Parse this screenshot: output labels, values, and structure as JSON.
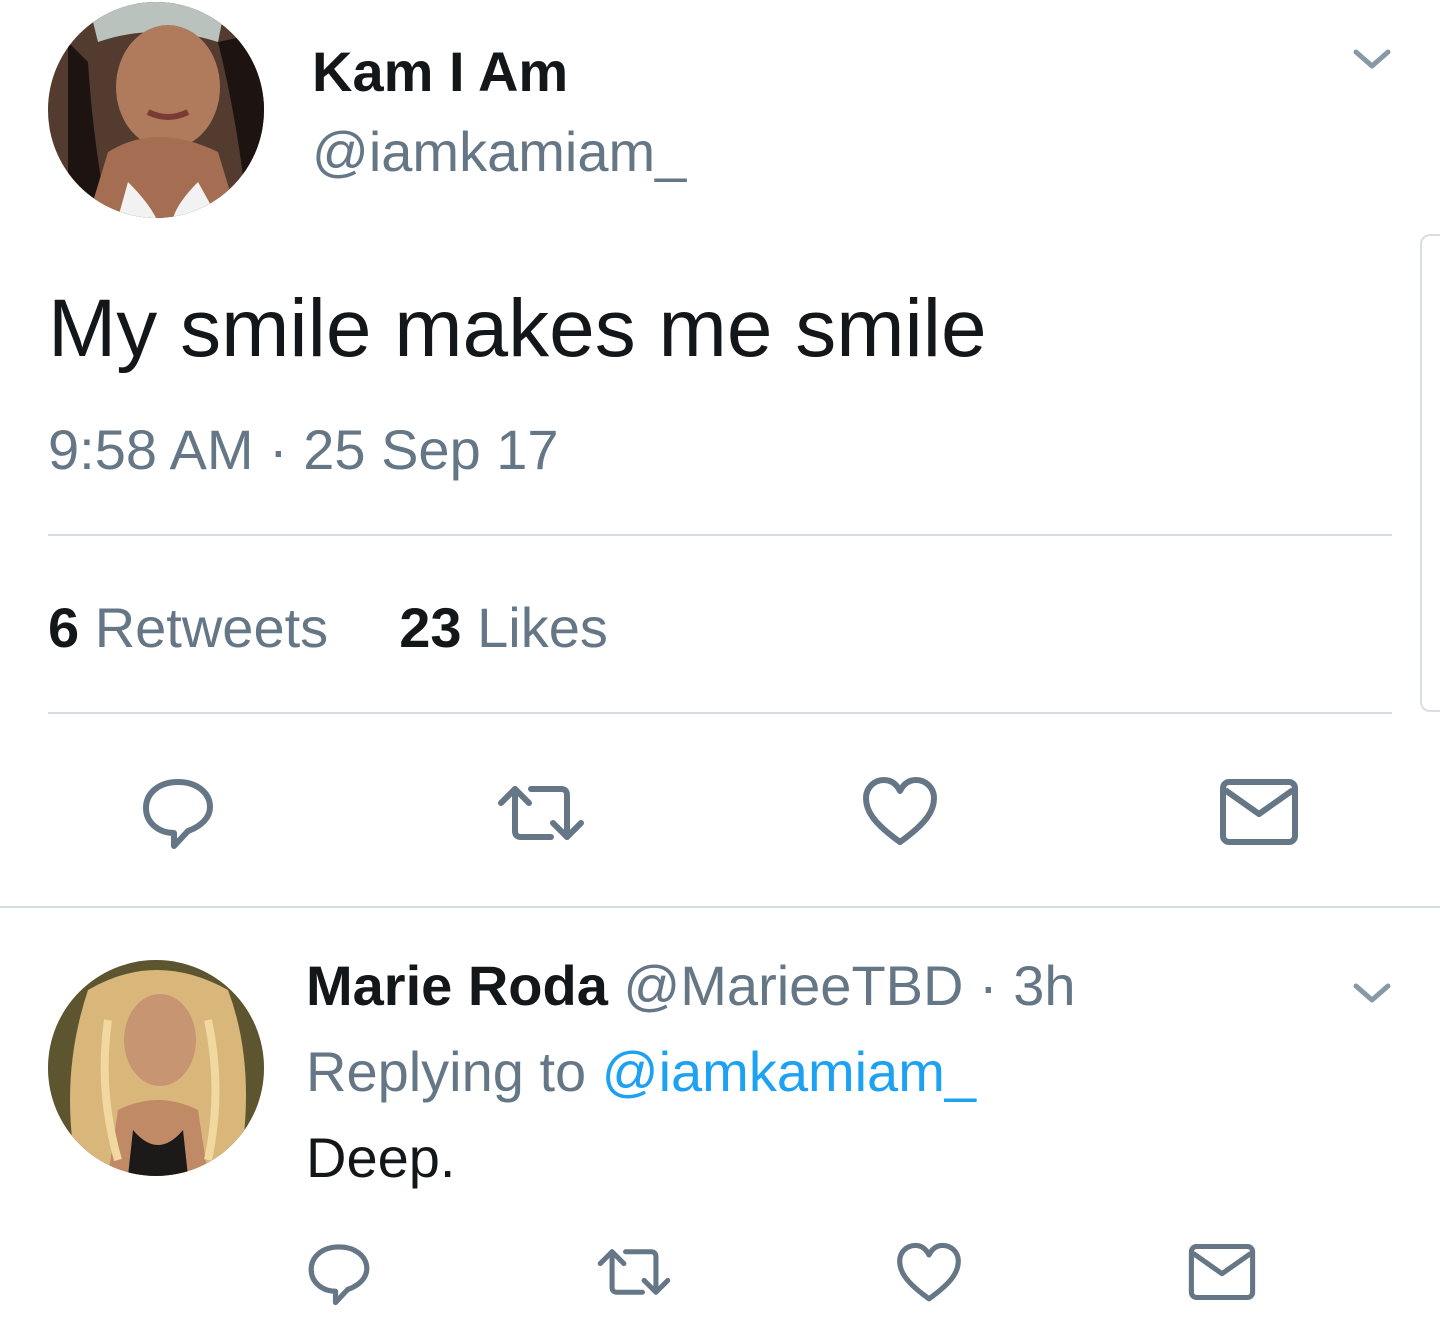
{
  "tweet": {
    "author_name": "Kam I Am",
    "author_handle": "@iamkamiam_",
    "text": "My smile makes me smile",
    "timestamp": "9:58 AM · 25 Sep 17",
    "retweets_count": "6",
    "retweets_label": "Retweets",
    "likes_count": "23",
    "likes_label": "Likes",
    "avatar_icon": "avatar-photo",
    "menu_icon": "chevron-down-icon",
    "actions": [
      "reply-icon",
      "retweet-icon",
      "like-icon",
      "direct-message-icon"
    ]
  },
  "reply": {
    "author_name": "Marie Roda",
    "author_handle": "@MarieeTBD",
    "time": "· 3h",
    "replying_prefix": "Replying to",
    "replying_handle": "@iamkamiam_",
    "text": "Deep.",
    "actions": [
      "reply-icon",
      "retweet-icon",
      "like-icon",
      "direct-message-icon"
    ]
  },
  "colors": {
    "text_primary": "#14171a",
    "text_secondary": "#657786",
    "link": "#1da1f2",
    "divider": "#d5dce2"
  }
}
